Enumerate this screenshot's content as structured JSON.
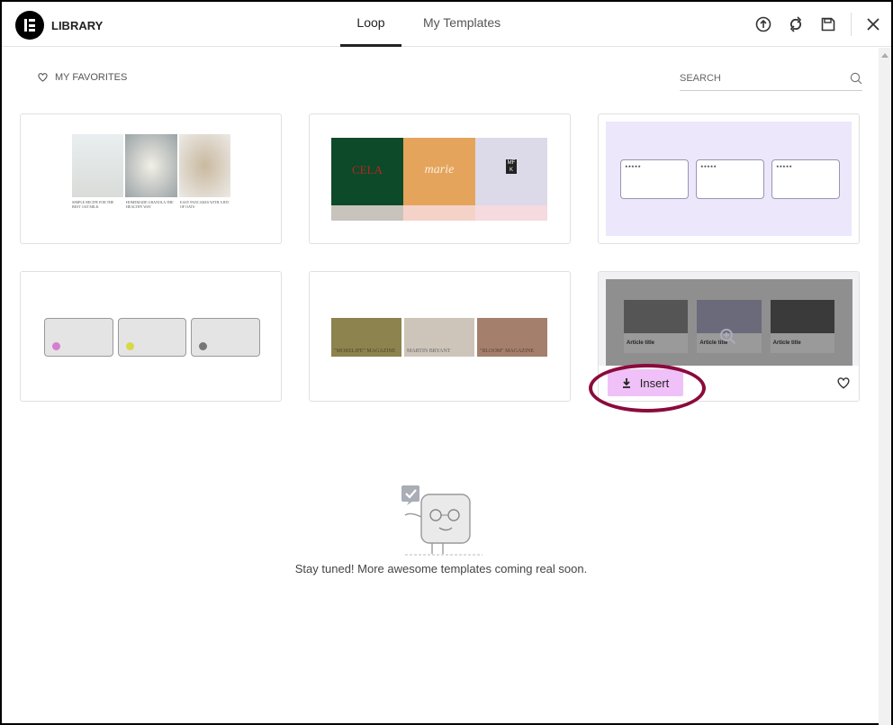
{
  "header": {
    "title": "LIBRARY",
    "tabs": [
      {
        "label": "Loop",
        "active": true
      },
      {
        "label": "My Templates",
        "active": false
      }
    ],
    "icons": [
      "upload-icon",
      "sync-icon",
      "save-icon",
      "close-icon"
    ]
  },
  "toolbar": {
    "favorites_label": "MY FAVORITES",
    "search_placeholder": "SEARCH"
  },
  "templates": [
    {
      "texts": [
        "SIMPLE RECIPE FOR THE BEST OAT MILK",
        "HOMEMADE GRANOLA THE HEALTHY WAY",
        "EASY PANCAKES WITH A BIT OF OATS"
      ]
    },
    {
      "texts": [
        "CELA",
        "marie",
        "MFK"
      ]
    },
    {
      "texts": [
        "★★★★★",
        "★★★★★",
        "★★★★★"
      ]
    },
    {
      "texts": [
        "",
        "",
        ""
      ]
    },
    {
      "texts": [
        "\"MORELIFE\" MAGAZINE",
        "MARTIN BRYANT",
        "\"BLOOM\" MAGAZINE"
      ]
    },
    {
      "texts": [
        "Article title",
        "Article title",
        "Article title"
      ],
      "hovered": true,
      "insert_label": "Insert"
    }
  ],
  "empty_state": {
    "message": "Stay tuned! More awesome templates coming real soon."
  },
  "colors": {
    "accent_insert": "#f0c1f8",
    "highlight_ring": "#8a0b3c"
  }
}
